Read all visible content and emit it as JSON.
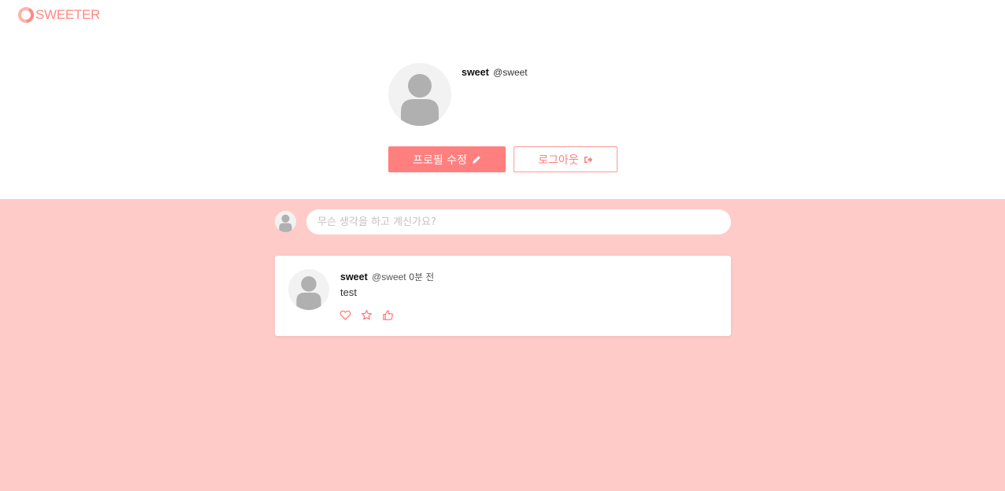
{
  "app": {
    "logo_text": "SWEETER",
    "brand_color": "#ff7f7f",
    "feed_background": "#ffcbc9"
  },
  "profile": {
    "display_name": "sweet",
    "handle": "@sweet",
    "avatar_icon": "user-avatar-icon",
    "edit_button_label": "프로필 수정",
    "edit_button_icon": "pencil-icon",
    "logout_button_label": "로그아웃",
    "logout_button_icon": "sign-out-icon"
  },
  "composer": {
    "placeholder": "무슨 생각을 하고 계신가요?",
    "value": ""
  },
  "feed": {
    "tweets": [
      {
        "display_name": "sweet",
        "handle": "@sweet",
        "time": "0분 전",
        "text": "test",
        "actions": [
          "heart-icon",
          "star-icon",
          "thumbs-up-icon"
        ]
      }
    ]
  }
}
